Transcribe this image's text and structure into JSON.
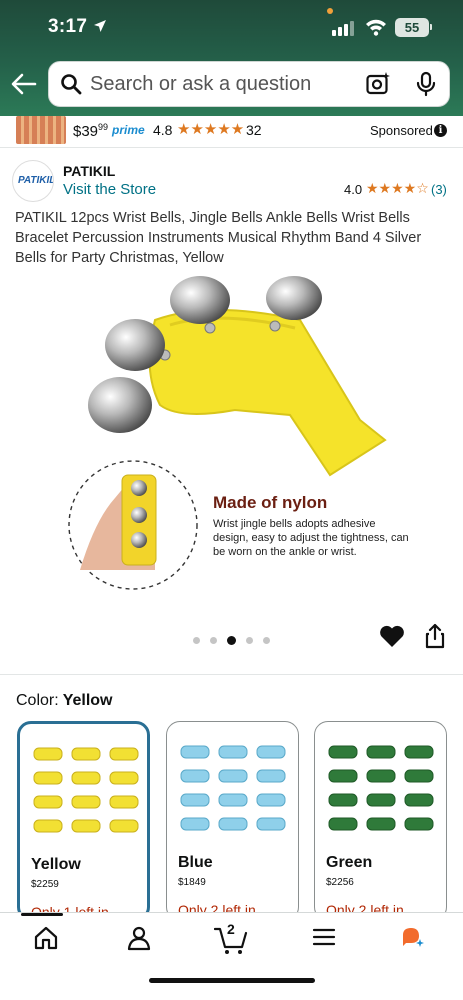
{
  "status_bar": {
    "time": "3:17",
    "battery": "55"
  },
  "search": {
    "placeholder": "Search or ask a question"
  },
  "sponsored": {
    "price_whole": "$39",
    "price_fraction": "99",
    "prime_label": "prime",
    "rating": "4.8",
    "stars": "★★★★★",
    "count": "32",
    "label": "Sponsored"
  },
  "brand": {
    "logo_text": "PATIKIL",
    "name": "PATIKIL",
    "visit_store": "Visit the Store",
    "rating": "4.0",
    "stars": "★★★★☆",
    "count": "(3)"
  },
  "product": {
    "title": "PATIKIL 12pcs Wrist Bells, Jingle Bells Ankle Bells Wrist Bells Bracelet Percussion Instruments Musical Rhythm Band 4 Silver Bells for Party Christmas, Yellow",
    "image_heading": "Made of nylon",
    "image_caption": "Wrist jingle bells adopts adhesive design, easy to adjust the tightness, can be worn on the ankle or wrist.",
    "image_count": 5,
    "active_image": 3
  },
  "color": {
    "label": "Color:",
    "selected": "Yellow",
    "options": [
      {
        "name": "Yellow",
        "price_whole": "$22",
        "price_fraction": "59",
        "stock": "Only 1 left in",
        "color": "#f2e033"
      },
      {
        "name": "Blue",
        "price_whole": "$18",
        "price_fraction": "49",
        "stock": "Only 2 left in",
        "color": "#8fd0ea"
      },
      {
        "name": "Green",
        "price_whole": "$22",
        "price_fraction": "56",
        "stock": "Only 2 left in",
        "color": "#2f7a3a"
      }
    ]
  },
  "nav": {
    "cart_count": "2",
    "items": [
      "home-icon",
      "account-icon",
      "cart-icon",
      "menu-icon",
      "rufus-icon"
    ]
  },
  "colors": {
    "header_green": "#24614a",
    "link": "#007185",
    "star": "#de7921",
    "stock_red": "#b12704",
    "selected_border": "#2a6f94"
  }
}
